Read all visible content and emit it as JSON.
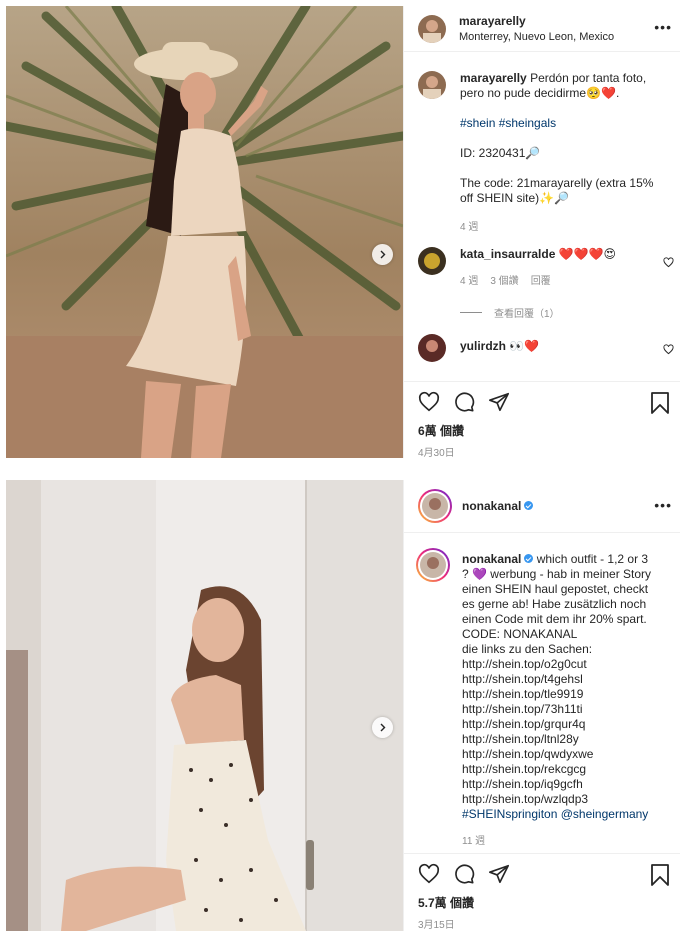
{
  "post1": {
    "header": {
      "username": "marayarelly",
      "location": "Monterrey, Nuevo Leon, Mexico"
    },
    "caption": {
      "username": "marayarelly",
      "line1": "Perdón por tanta foto, pero no pude decidirme🥺❤️.",
      "hashtags": "#shein #sheingals",
      "id_line": "ID: 2320431🔎",
      "code_line": "The code: 21marayarelly (extra 15% off SHEIN site)✨🔎",
      "time": "4 週"
    },
    "comments": [
      {
        "username": "kata_insaurralde",
        "text": "❤️❤️❤️😍",
        "time": "4 週",
        "likes": "3 個讚",
        "reply": "回覆"
      },
      {
        "username": "yulirdzh",
        "text": "👀❤️"
      }
    ],
    "view_replies": "查看回覆（1）",
    "likes": "6萬 個讚",
    "date": "4月30日"
  },
  "post2": {
    "header": {
      "username": "nonakanal"
    },
    "caption": {
      "username": "nonakanal",
      "line1": "which outfit - 1,2 or 3 ? 💜",
      "line2": "werbung - hab in meiner Story einen SHEIN haul gepostet, checkt es gerne ab! Habe zusätzlich noch einen Code mit dem ihr 20% spart. CODE: NONAKANAL",
      "line3": "die links zu den Sachen:",
      "links": [
        "http://shein.top/o2g0cut",
        "http://shein.top/t4gehsl",
        "http://shein.top/tle9919",
        "http://shein.top/73h11ti",
        "http://shein.top/grqur4q",
        "http://shein.top/ltnl28y",
        "http://shein.top/qwdyxwe",
        "http://shein.top/rekcgcg",
        "http://shein.top/iq9gcfh",
        "http://shein.top/wzlqdp3"
      ],
      "hashtag": "#SHEINspringiton",
      "mention": "@sheingermany",
      "time": "11 週"
    },
    "likes": "5.7萬 個讚",
    "date": "3月15日"
  },
  "icons": [
    "heart-icon",
    "comment-icon",
    "share-icon",
    "bookmark-icon",
    "more-icon",
    "chevron-right-icon",
    "verified-badge-icon"
  ],
  "colors": {
    "text": "#262626",
    "muted": "#8e8e8e",
    "link": "#00376b",
    "verified": "#3897f0",
    "border": "#efefef"
  }
}
